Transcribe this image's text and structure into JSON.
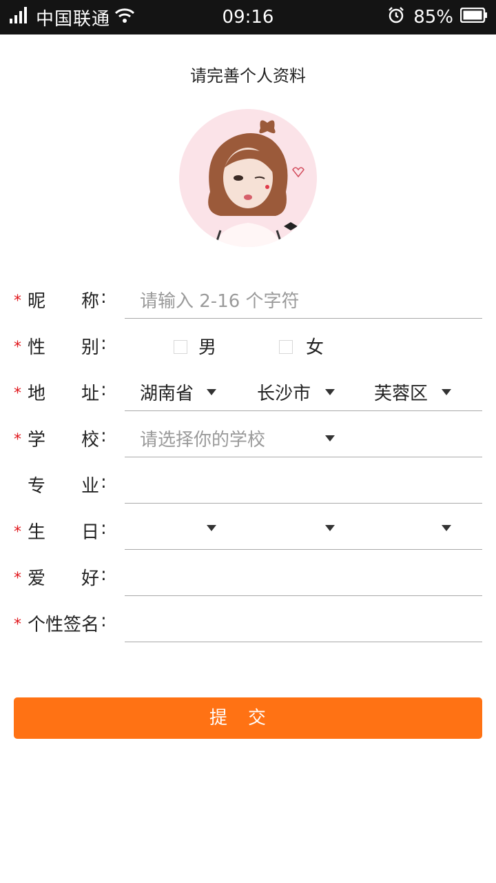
{
  "status_bar": {
    "carrier": "中国联通",
    "time": "09:16",
    "battery_pct": "85%",
    "icons": [
      "signal-icon",
      "wifi-icon",
      "alarm-icon",
      "battery-icon"
    ]
  },
  "page": {
    "title": "请完善个人资料"
  },
  "form": {
    "nickname": {
      "label_a": "昵",
      "label_b": "称",
      "colon": ":",
      "placeholder": "请输入 2-16 个字符",
      "required": true
    },
    "gender": {
      "label_a": "性",
      "label_b": "别",
      "colon": ":",
      "options": [
        "男",
        "女"
      ],
      "required": true
    },
    "address": {
      "label_a": "地",
      "label_b": "址",
      "colon": ":",
      "province": "湖南省",
      "city": "长沙市",
      "district": "芙蓉区",
      "required": true
    },
    "school": {
      "label_a": "学",
      "label_b": "校",
      "colon": ":",
      "placeholder": "请选择你的学校",
      "required": true
    },
    "major": {
      "label_a": "专",
      "label_b": "业",
      "colon": ":",
      "value": "",
      "required": false
    },
    "birthday": {
      "label_a": "生",
      "label_b": "日",
      "colon": ":",
      "year": "",
      "month": "",
      "day": "",
      "required": true
    },
    "hobby": {
      "label_a": "爱",
      "label_b": "好",
      "colon": ":",
      "value": "",
      "required": true
    },
    "signature": {
      "label": "个性签名",
      "colon": ":",
      "value": "",
      "required": true
    },
    "required_mark": "*"
  },
  "submit_label": "提交",
  "colors": {
    "accent": "#ff7214",
    "required": "#e0161b",
    "status_bar": "#141414"
  }
}
